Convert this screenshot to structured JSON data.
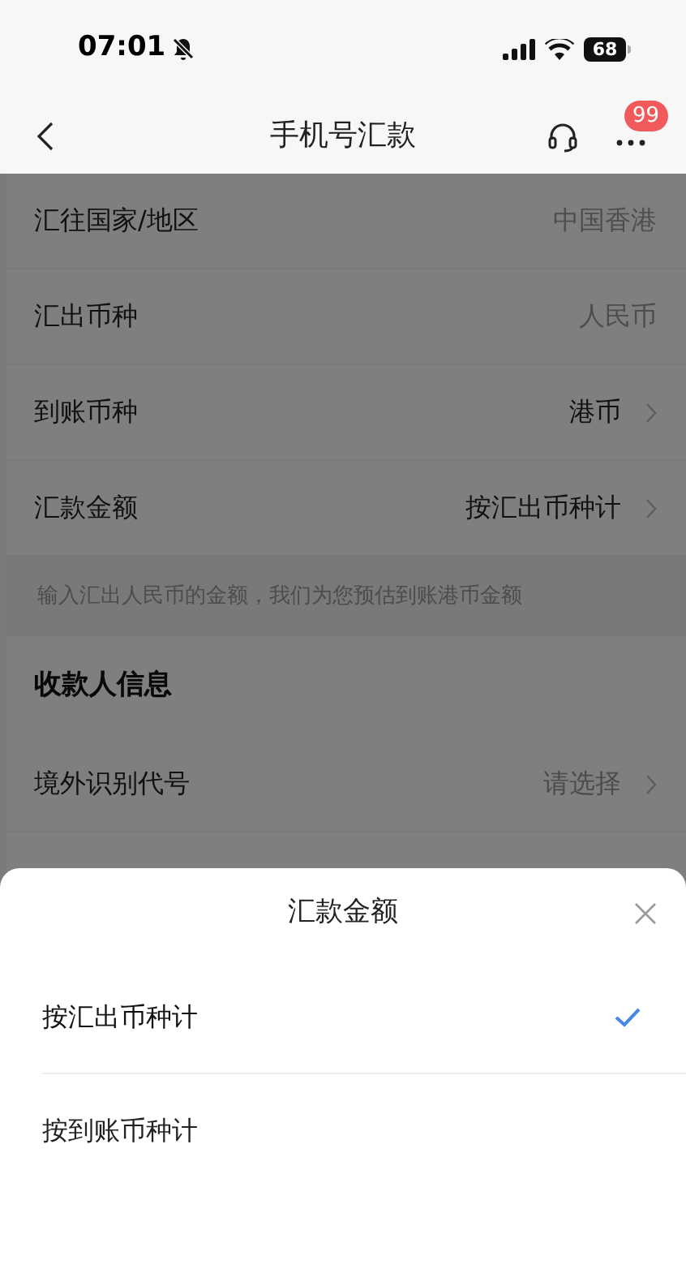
{
  "status_bar": {
    "time": "07:01",
    "silent": true,
    "battery": "68"
  },
  "nav_bar": {
    "title": "手机号汇款",
    "badge": "99"
  },
  "form_rows": [
    {
      "kind": "field",
      "label": "汇往国家/地区",
      "value": "中国香港",
      "disabled": true,
      "chevron": false
    },
    {
      "kind": "field",
      "label": "汇出币种",
      "value": "人民币",
      "disabled": true,
      "chevron": false
    },
    {
      "kind": "field",
      "label": "到账币种",
      "value": "港币",
      "disabled": false,
      "chevron": true
    },
    {
      "kind": "field",
      "label": "汇款金额",
      "value": "按汇出币种计",
      "disabled": false,
      "chevron": true
    },
    {
      "kind": "note",
      "text": "输入汇出人民币的金额，我们为您预估到账港币金额"
    },
    {
      "kind": "section",
      "text": "收款人信息"
    },
    {
      "kind": "field",
      "label": "境外识别代号",
      "placeholder": "请选择",
      "chevron": true
    }
  ],
  "sheet": {
    "title": "汇款金额",
    "options": [
      {
        "label": "按汇出币种计",
        "selected": true
      },
      {
        "label": "按到账币种计",
        "selected": false
      }
    ]
  }
}
